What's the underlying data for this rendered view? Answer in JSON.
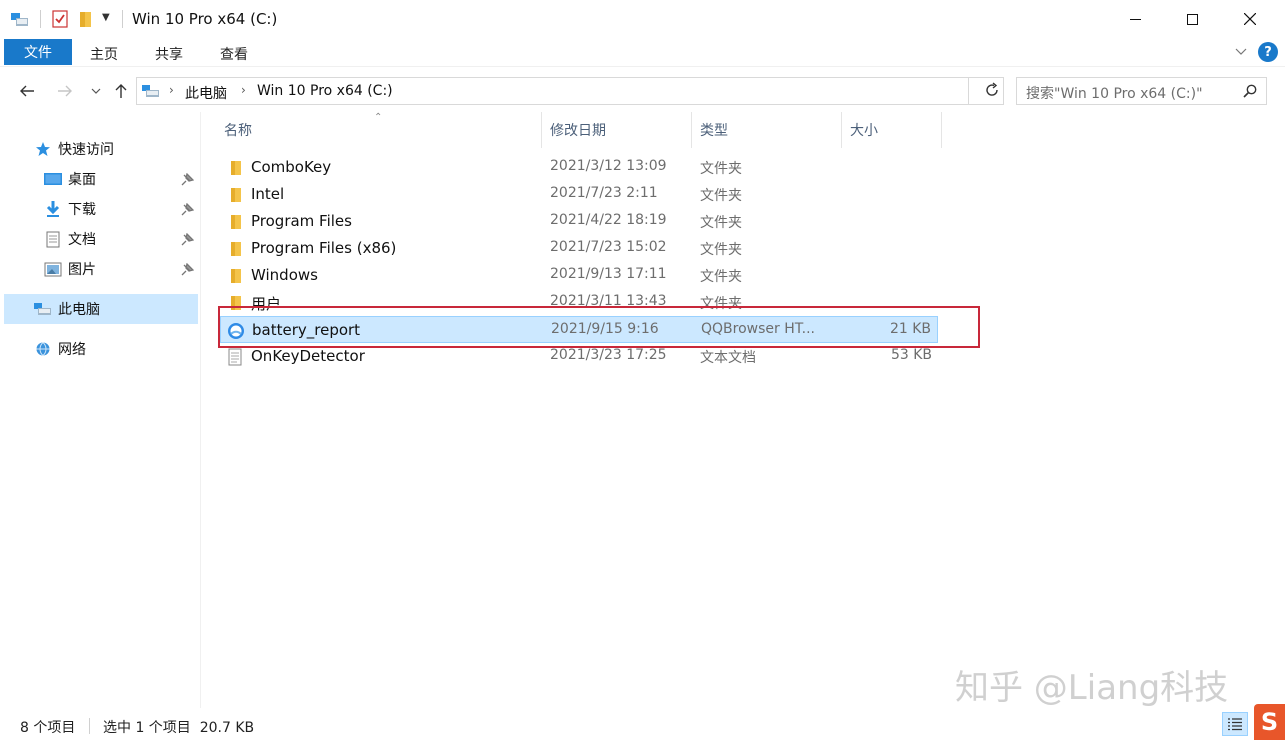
{
  "window": {
    "title": "Win 10 Pro x64 (C:)",
    "minimize_glyph": "—",
    "maximize_glyph": "☐",
    "close_glyph": "✕"
  },
  "ribbon": {
    "tabs": [
      "文件",
      "主页",
      "共享",
      "查看"
    ],
    "accent_color": "#1979ca",
    "help_label": "?"
  },
  "address": {
    "path": [
      "此电脑",
      "Win 10 Pro x64 (C:)"
    ],
    "search_placeholder": "搜索\"Win 10 Pro x64 (C:)\""
  },
  "sidebar": {
    "quick_access": "快速访问",
    "items": [
      {
        "label": "桌面",
        "icon": "desktop-icon",
        "pinned": true
      },
      {
        "label": "下载",
        "icon": "download-icon",
        "pinned": true
      },
      {
        "label": "文档",
        "icon": "document-icon",
        "pinned": true
      },
      {
        "label": "图片",
        "icon": "pictures-icon",
        "pinned": true
      }
    ],
    "this_pc": "此电脑",
    "network": "网络"
  },
  "columns": [
    "名称",
    "修改日期",
    "类型",
    "大小"
  ],
  "files": [
    {
      "name": "ComboKey",
      "date": "2021/3/12 13:09",
      "type": "文件夹",
      "size": "",
      "icon": "folder-icon"
    },
    {
      "name": "Intel",
      "date": "2021/7/23 2:11",
      "type": "文件夹",
      "size": "",
      "icon": "folder-icon"
    },
    {
      "name": "Program Files",
      "date": "2021/4/22 18:19",
      "type": "文件夹",
      "size": "",
      "icon": "folder-icon"
    },
    {
      "name": "Program Files (x86)",
      "date": "2021/7/23 15:02",
      "type": "文件夹",
      "size": "",
      "icon": "folder-icon"
    },
    {
      "name": "Windows",
      "date": "2021/9/13 17:11",
      "type": "文件夹",
      "size": "",
      "icon": "folder-icon"
    },
    {
      "name": "用户",
      "date": "2021/3/11 13:43",
      "type": "文件夹",
      "size": "",
      "icon": "folder-icon"
    },
    {
      "name": "battery_report",
      "date": "2021/9/15 9:16",
      "type": "QQBrowser HT...",
      "size": "21 KB",
      "icon": "browser-html-icon",
      "selected": true
    },
    {
      "name": "OnKeyDetector",
      "date": "2021/3/23 17:25",
      "type": "文本文档",
      "size": "53 KB",
      "icon": "text-file-icon"
    }
  ],
  "status": {
    "item_count": "8 个项目",
    "selection": "选中 1 个项目  20.7 KB"
  },
  "watermark": "知乎 @Liang科技",
  "colors": {
    "selection_bg": "#cce8ff",
    "selection_border": "#99d1ff",
    "highlight_box": "#c8283a",
    "folder_yellow": "#f4c44a"
  }
}
